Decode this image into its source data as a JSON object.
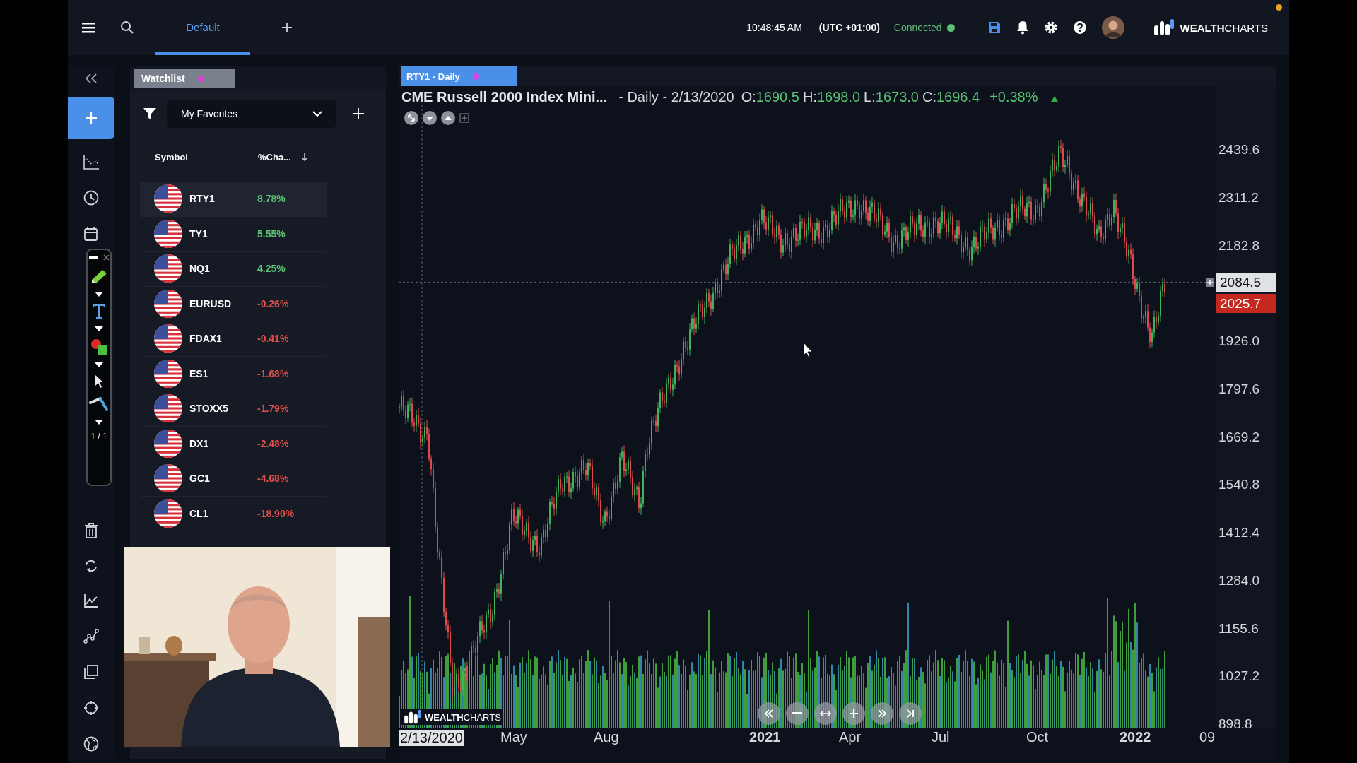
{
  "top_bar": {
    "tabs": [
      {
        "label": "Default",
        "selected": true
      }
    ],
    "time": "10:48:45 AM",
    "timezone": "(UTC +01:00)",
    "connection": {
      "label": "Connected",
      "connected": true
    },
    "logo": "**WEALTH**CHARTS"
  },
  "watchlist": {
    "tab": "Watchlist",
    "list_name": "My Favorites",
    "columns": [
      "Symbol",
      "%Cha..."
    ],
    "rows": [
      {
        "symbol": "RTY1",
        "change": "8.78%",
        "color": "#5cc274",
        "selected": true
      },
      {
        "symbol": "TY1",
        "change": "5.55%",
        "color": "#5cc274",
        "selected": false
      },
      {
        "symbol": "NQ1",
        "change": "4.25%",
        "color": "#5cc274",
        "selected": false
      },
      {
        "symbol": "EURUSD",
        "change": "-0.26%",
        "color": "#e0504a",
        "selected": false
      },
      {
        "symbol": "FDAX1",
        "change": "-0.41%",
        "color": "#e0504a",
        "selected": false
      },
      {
        "symbol": "ES1",
        "change": "-1.68%",
        "color": "#e0504a",
        "selected": false
      },
      {
        "symbol": "STOXX5",
        "change": "-1.79%",
        "color": "#e0504a",
        "selected": false
      },
      {
        "symbol": "DX1",
        "change": "-2.48%",
        "color": "#e0504a",
        "selected": false
      },
      {
        "symbol": "GC1",
        "change": "-4.68%",
        "color": "#e0504a",
        "selected": false
      },
      {
        "symbol": "CL1",
        "change": "-18.90%",
        "color": "#e0504a",
        "selected": false
      }
    ]
  },
  "drawing_toolbar": {
    "page": "1 / 1"
  },
  "chart": {
    "tab": "RTY1 - Daily",
    "symbol_name": "CME Russell 2000 Index Mini...",
    "interval_date": "- Daily - 2/13/2020",
    "ohlc": [
      {
        "label": "O:",
        "value": "1690.5"
      },
      {
        "label": "H:",
        "value": "1698.0"
      },
      {
        "label": "L:",
        "value": "1673.0"
      },
      {
        "label": "C:",
        "value": "1696.4"
      }
    ],
    "change": "+0.38%",
    "rising": true,
    "price_axis": [
      "2439.6",
      "2311.2",
      "2182.8",
      "1926.0",
      "1797.6",
      "1669.2",
      "1540.8",
      "1412.4",
      "1284.0",
      "1155.6",
      "1027.2",
      "898.8"
    ],
    "crosshair_price": "2084.5",
    "last_price": "2025.7",
    "time_axis": [
      {
        "label": "2/13/2020",
        "kind": "cursor"
      },
      {
        "label": "May",
        "kind": "month"
      },
      {
        "label": "Aug",
        "kind": "month"
      },
      {
        "label": "2021",
        "kind": "year"
      },
      {
        "label": "Apr",
        "kind": "month"
      },
      {
        "label": "Jul",
        "kind": "month"
      },
      {
        "label": "Oct",
        "kind": "month"
      },
      {
        "label": "2022",
        "kind": "year"
      },
      {
        "label": "09",
        "kind": "month"
      }
    ],
    "watermark": "**WEALTH**CHARTS"
  }
}
